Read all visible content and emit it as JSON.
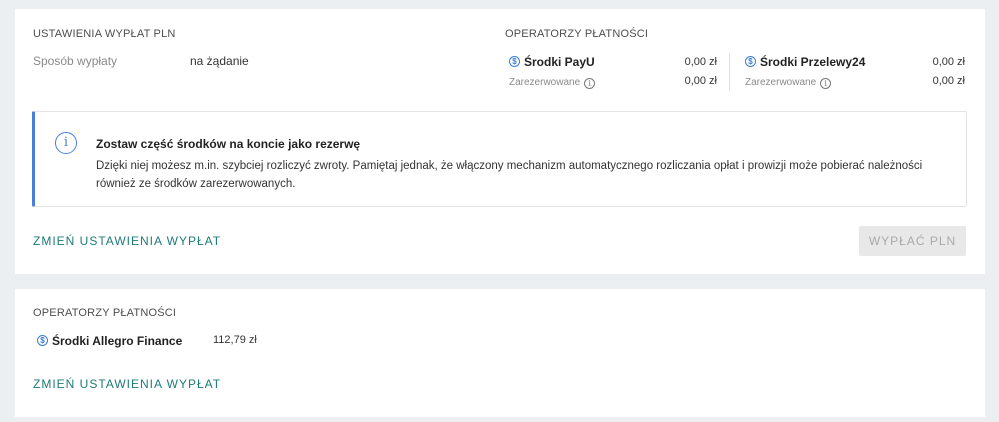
{
  "payout_settings": {
    "title": "USTAWIENIA WYPŁAT PLN",
    "method_label": "Sposób wypłaty",
    "method_value": "na żądanie"
  },
  "operators": {
    "title": "OPERATORZY PŁATNOŚCI",
    "payu": {
      "icon": "dollar-icon",
      "name": "Środki PayU",
      "amount": "0,00 zł",
      "reserved_label": "Zarezerwowane",
      "reserved_amount": "0,00 zł"
    },
    "przelewy24": {
      "icon": "dollar-icon",
      "name": "Środki Przelewy24",
      "amount": "0,00 zł",
      "reserved_label": "Zarezerwowane",
      "reserved_amount": "0,00 zł"
    }
  },
  "notice": {
    "icon": "info-icon",
    "title": "Zostaw część środków na koncie jako rezerwę",
    "text": "Dzięki niej możesz m.in. szybciej rozliczyć zwroty. Pamiętaj jednak, że włączony mechanizm automatycznego rozliczania opłat i prowizji może pobierać należności również ze środków zarezerwowanych."
  },
  "actions": {
    "change_settings": "ZMIEŃ USTAWIENIA WYPŁAT",
    "payout": "WYPŁAĆ PLN"
  },
  "allegro": {
    "title": "OPERATORZY PŁATNOŚCI",
    "name": "Środki Allegro Finance",
    "amount": "112,79 zł",
    "change_settings": "ZMIEŃ USTAWIENIA WYPŁAT"
  },
  "colors": {
    "accent_link": "#1e7a7a",
    "info_blue": "#4a7fd9",
    "page_bg": "#eceff1"
  }
}
